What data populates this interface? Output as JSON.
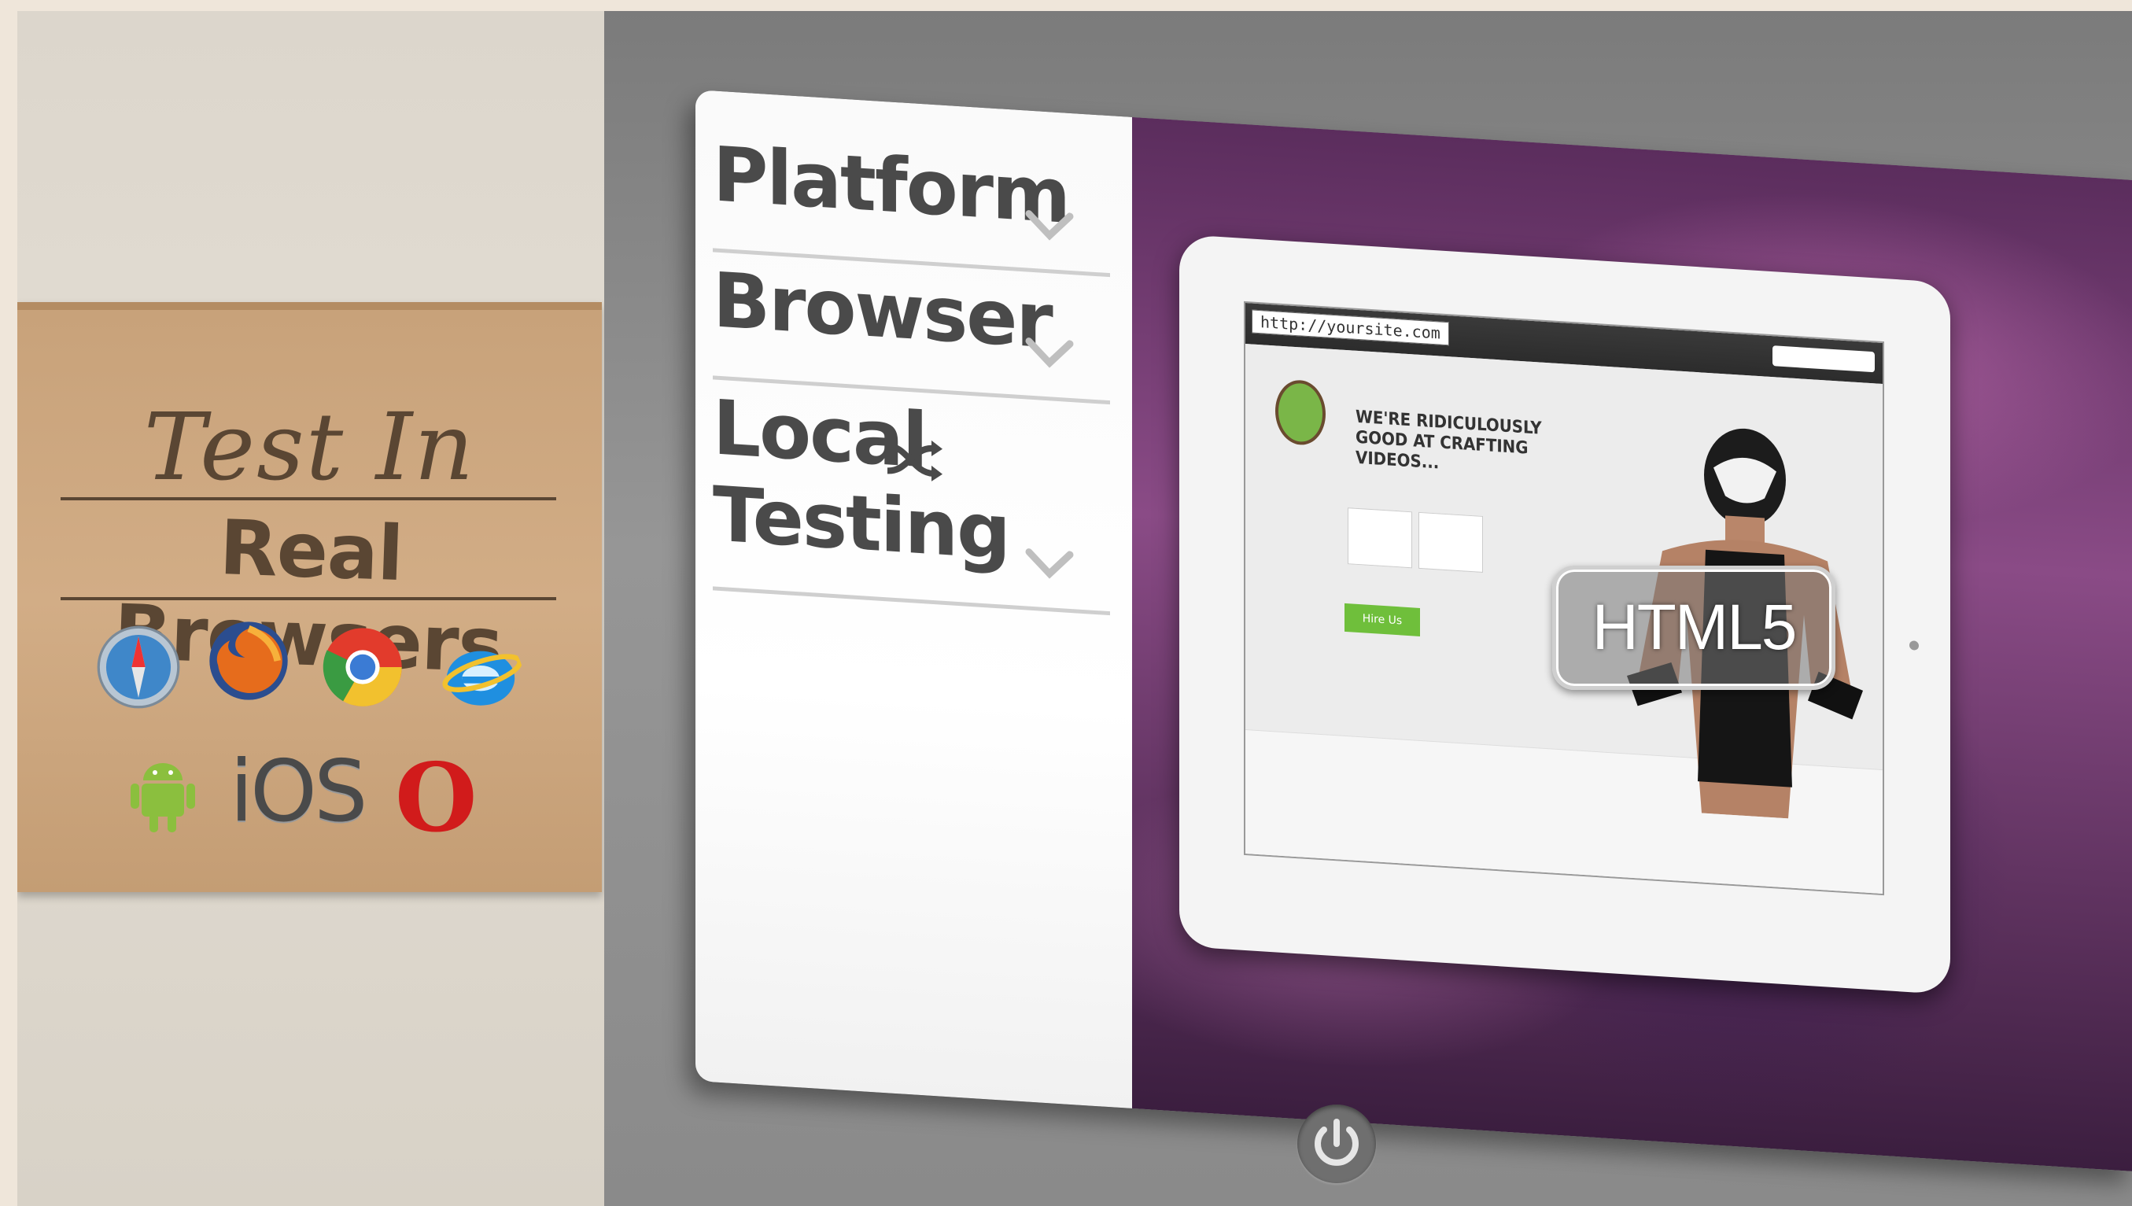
{
  "promo": {
    "line1": "Test In",
    "line2": "Real Browsers",
    "browsers": [
      "safari-icon",
      "firefox-icon",
      "chrome-icon",
      "ie-icon"
    ],
    "platforms": {
      "android_icon": "android-icon",
      "ios_label": "iOS",
      "opera_label": "O"
    }
  },
  "menu": {
    "items": [
      {
        "label": "Platform"
      },
      {
        "label": "Browser"
      },
      {
        "label_line1": "Local",
        "label_line2": "Testing"
      }
    ]
  },
  "preview": {
    "url": "http://yoursite.com",
    "headline": "WE'RE RIDICULOUSLY GOOD AT CRAFTING VIDEOS...",
    "cta": "Hire Us"
  },
  "badge": {
    "label": "HTML5"
  },
  "colors": {
    "card": "#c8a27a",
    "card_text": "#5a4633",
    "menu_text": "#4a4a4a",
    "bezel": "#8a8a8a",
    "cta_green": "#6fbf3b"
  },
  "icons": {
    "power": "power-icon",
    "shuffle": "shuffle-icon",
    "chevron": "chevron-down-icon"
  }
}
